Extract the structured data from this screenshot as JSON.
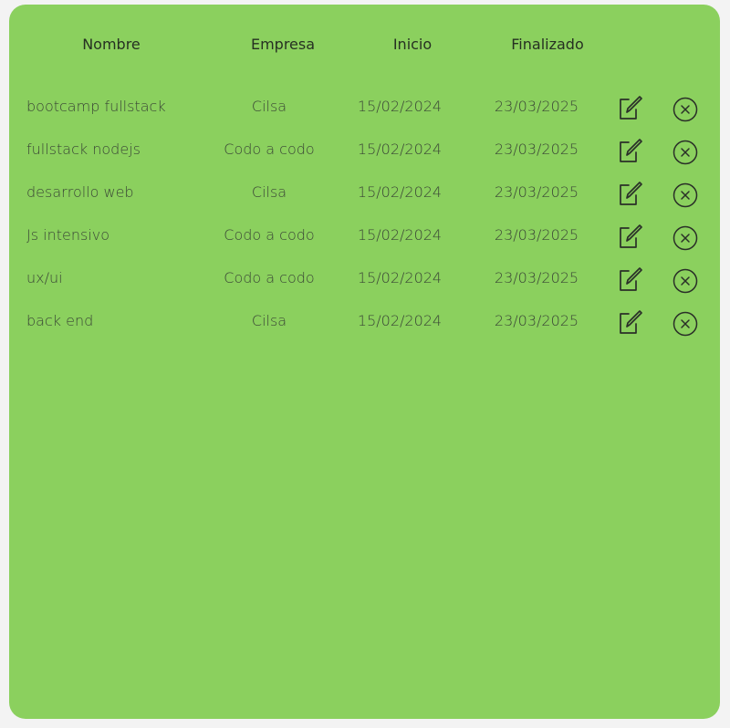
{
  "table": {
    "headers": {
      "nombre": "Nombre",
      "empresa": "Empresa",
      "inicio": "Inicio",
      "finalizado": "Finalizado"
    },
    "rows": [
      {
        "nombre": "bootcamp fullstack",
        "empresa": "Cilsa",
        "inicio": "15/02/2024",
        "finalizado": "23/03/2025"
      },
      {
        "nombre": "fullstack nodejs",
        "empresa": "Codo a codo",
        "inicio": "15/02/2024",
        "finalizado": "23/03/2025"
      },
      {
        "nombre": "desarrollo web",
        "empresa": "Cilsa",
        "inicio": "15/02/2024",
        "finalizado": "23/03/2025"
      },
      {
        "nombre": "Js intensivo",
        "empresa": "Codo a codo",
        "inicio": "15/02/2024",
        "finalizado": "23/03/2025"
      },
      {
        "nombre": "ux/ui",
        "empresa": "Codo a codo",
        "inicio": "15/02/2024",
        "finalizado": "23/03/2025"
      },
      {
        "nombre": "back end",
        "empresa": "Cilsa",
        "inicio": "15/02/2024",
        "finalizado": "23/03/2025"
      }
    ],
    "row_actions": {
      "edit_icon": "edit-icon",
      "delete_icon": "close-circle-icon"
    }
  },
  "colors": {
    "panel_background": "#8bd05e",
    "page_background": "#f3f3f3",
    "text": "#2f3a2a"
  }
}
